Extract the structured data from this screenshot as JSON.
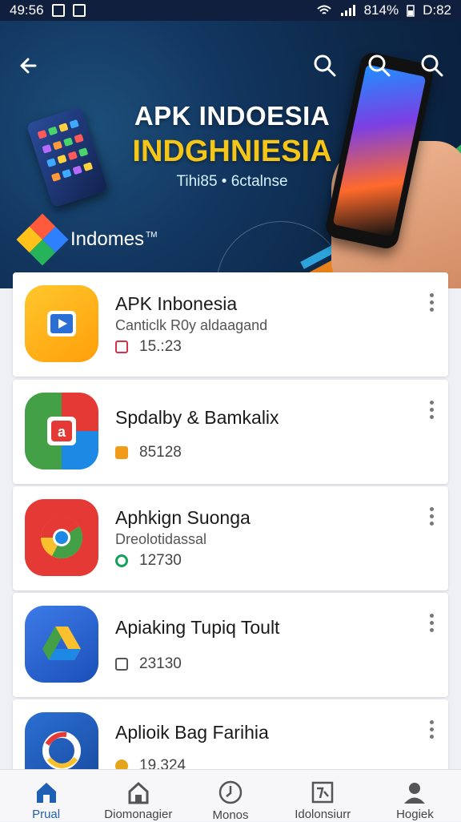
{
  "status_bar": {
    "time": "49:56",
    "battery": "814%",
    "clock_right": "D:82"
  },
  "banner": {
    "title": "APK INDOESIA",
    "subtitle": "INDGHNIESIA",
    "tagline": "Tihi85 • 6ctalnse",
    "brand": "Indomes",
    "brand_mark": "TM"
  },
  "colors": {
    "accent": "#1f5fb4",
    "banner_bg": "#123660",
    "subtitle_yellow": "#f5c518"
  },
  "apps": [
    {
      "name": "APK Inbonesia",
      "desc": "Canticlk R0y aldaagand",
      "count": "15.:23",
      "icon": "play-store-icon",
      "meta_icon": "calendar-icon"
    },
    {
      "name": "Spdalby & Bamkalix",
      "desc": "",
      "count": "85128",
      "icon": "app-a-icon",
      "meta_icon": "folder-icon"
    },
    {
      "name": "Aphkign Suonga",
      "desc": "Dreolotidassal",
      "count": "12730",
      "icon": "chrome-icon",
      "meta_icon": "target-icon"
    },
    {
      "name": "Apiaking Tupiq Toult",
      "desc": "",
      "count": "23130",
      "icon": "drive-icon",
      "meta_icon": "save-icon"
    },
    {
      "name": "Aplioik Bag Farihia",
      "desc": "",
      "count": "19.324",
      "icon": "o-app-icon",
      "meta_icon": "star-icon"
    }
  ],
  "nav": [
    {
      "label": "Prual",
      "icon": "home-icon"
    },
    {
      "label": "Diomonagier",
      "icon": "house-icon"
    },
    {
      "label": "Monos",
      "icon": "clock-icon"
    },
    {
      "label": "Idolonsiurr",
      "icon": "image-icon"
    },
    {
      "label": "Hogiek",
      "icon": "person-icon"
    }
  ]
}
